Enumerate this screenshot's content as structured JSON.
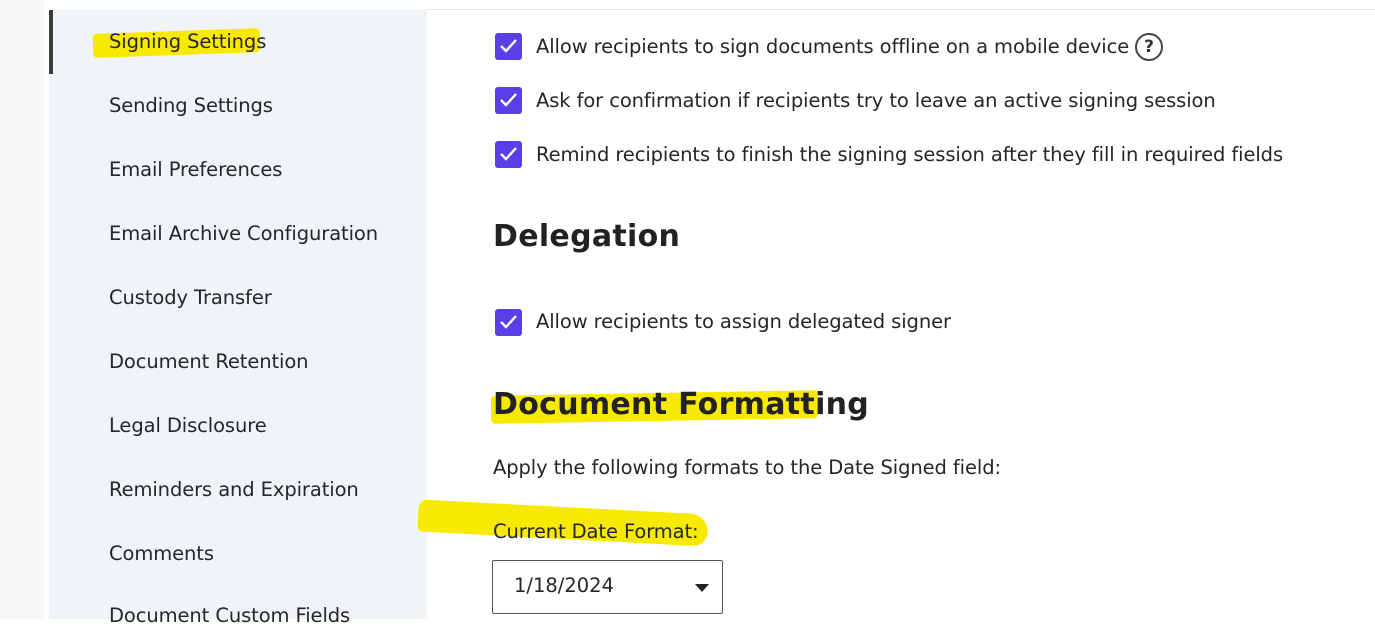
{
  "sidebar": {
    "items": [
      {
        "label": "Signing Settings",
        "active": true
      },
      {
        "label": "Sending Settings"
      },
      {
        "label": "Email Preferences"
      },
      {
        "label": "Email Archive Configuration"
      },
      {
        "label": "Custody Transfer"
      },
      {
        "label": "Document Retention"
      },
      {
        "label": "Legal Disclosure"
      },
      {
        "label": "Reminders and Expiration"
      },
      {
        "label": "Comments"
      },
      {
        "label": "Document Custom Fields"
      }
    ]
  },
  "signing": {
    "options": [
      {
        "label": "Allow recipients to sign documents offline on a mobile device",
        "checked": true,
        "help_icon": "question-circle-icon"
      },
      {
        "label": "Ask for confirmation if recipients try to leave an active signing session",
        "checked": true
      },
      {
        "label": "Remind recipients to finish the signing session after they fill in required fields",
        "checked": true
      }
    ]
  },
  "delegation": {
    "title": "Delegation",
    "options": [
      {
        "label": "Allow recipients to assign delegated signer",
        "checked": true
      }
    ]
  },
  "formatting": {
    "title": "Document Formatting",
    "description": "Apply the following formats to the Date Signed field:",
    "date_format_label": "Current Date Format:",
    "date_format_value": "1/18/2024"
  },
  "colors": {
    "checkbox": "#5a3fe6",
    "highlight": "#f7ea00",
    "sidebar_bg": "#f0f3f8"
  }
}
